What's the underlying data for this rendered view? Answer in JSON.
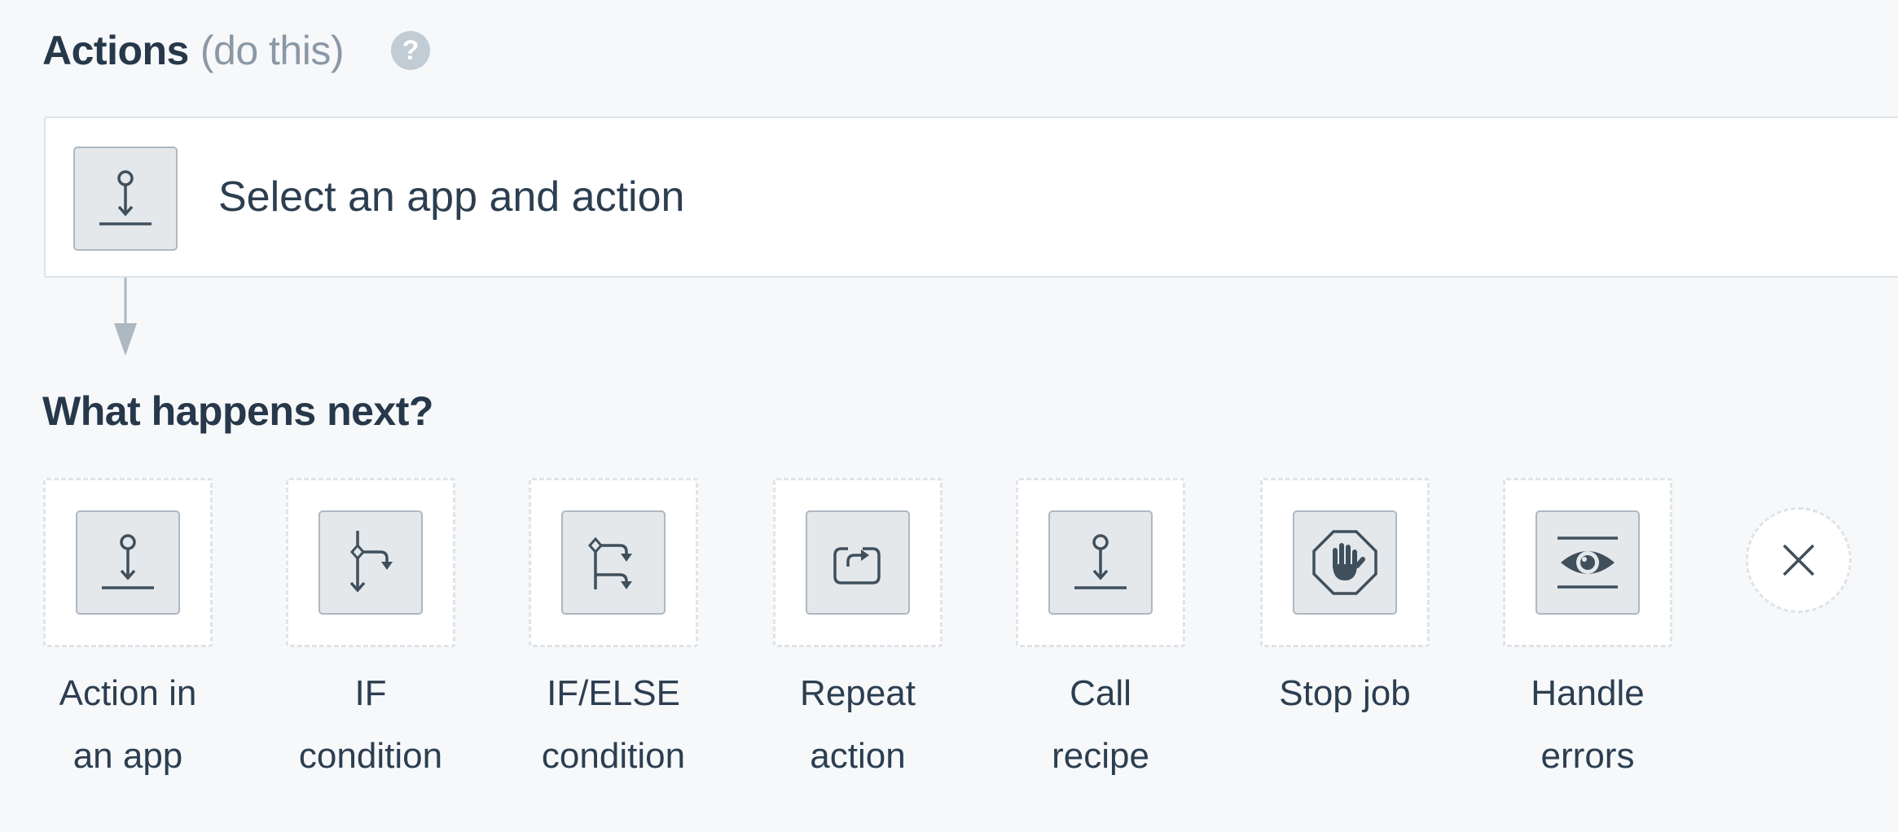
{
  "header": {
    "title": "Actions",
    "subtitle": "(do this)",
    "help_icon": "question-circle-icon",
    "help_glyph": "?"
  },
  "step": {
    "label": "Select an app and action",
    "icon": "action-in-app-icon"
  },
  "next": {
    "title": "What happens next?",
    "options": [
      {
        "line1": "Action in",
        "line2": "an app",
        "icon": "action-in-app-icon"
      },
      {
        "line1": "IF",
        "line2": "condition",
        "icon": "if-condition-icon"
      },
      {
        "line1": "IF/ELSE",
        "line2": "condition",
        "icon": "if-else-condition-icon"
      },
      {
        "line1": "Repeat",
        "line2": "action",
        "icon": "repeat-action-icon"
      },
      {
        "line1": "Call",
        "line2": "recipe",
        "icon": "call-recipe-icon"
      },
      {
        "line1": "Stop job",
        "line2": "",
        "icon": "stop-job-icon"
      },
      {
        "line1": "Handle",
        "line2": "errors",
        "icon": "handle-errors-icon"
      }
    ],
    "close_icon": "close-icon"
  },
  "colors": {
    "background": "#f6f8fa",
    "text": "#2c3e50",
    "muted": "#8b98a5",
    "icon_fill": "#e4e8eb",
    "icon_stroke": "#3f4f5c",
    "connector": "#aeb8c1"
  }
}
